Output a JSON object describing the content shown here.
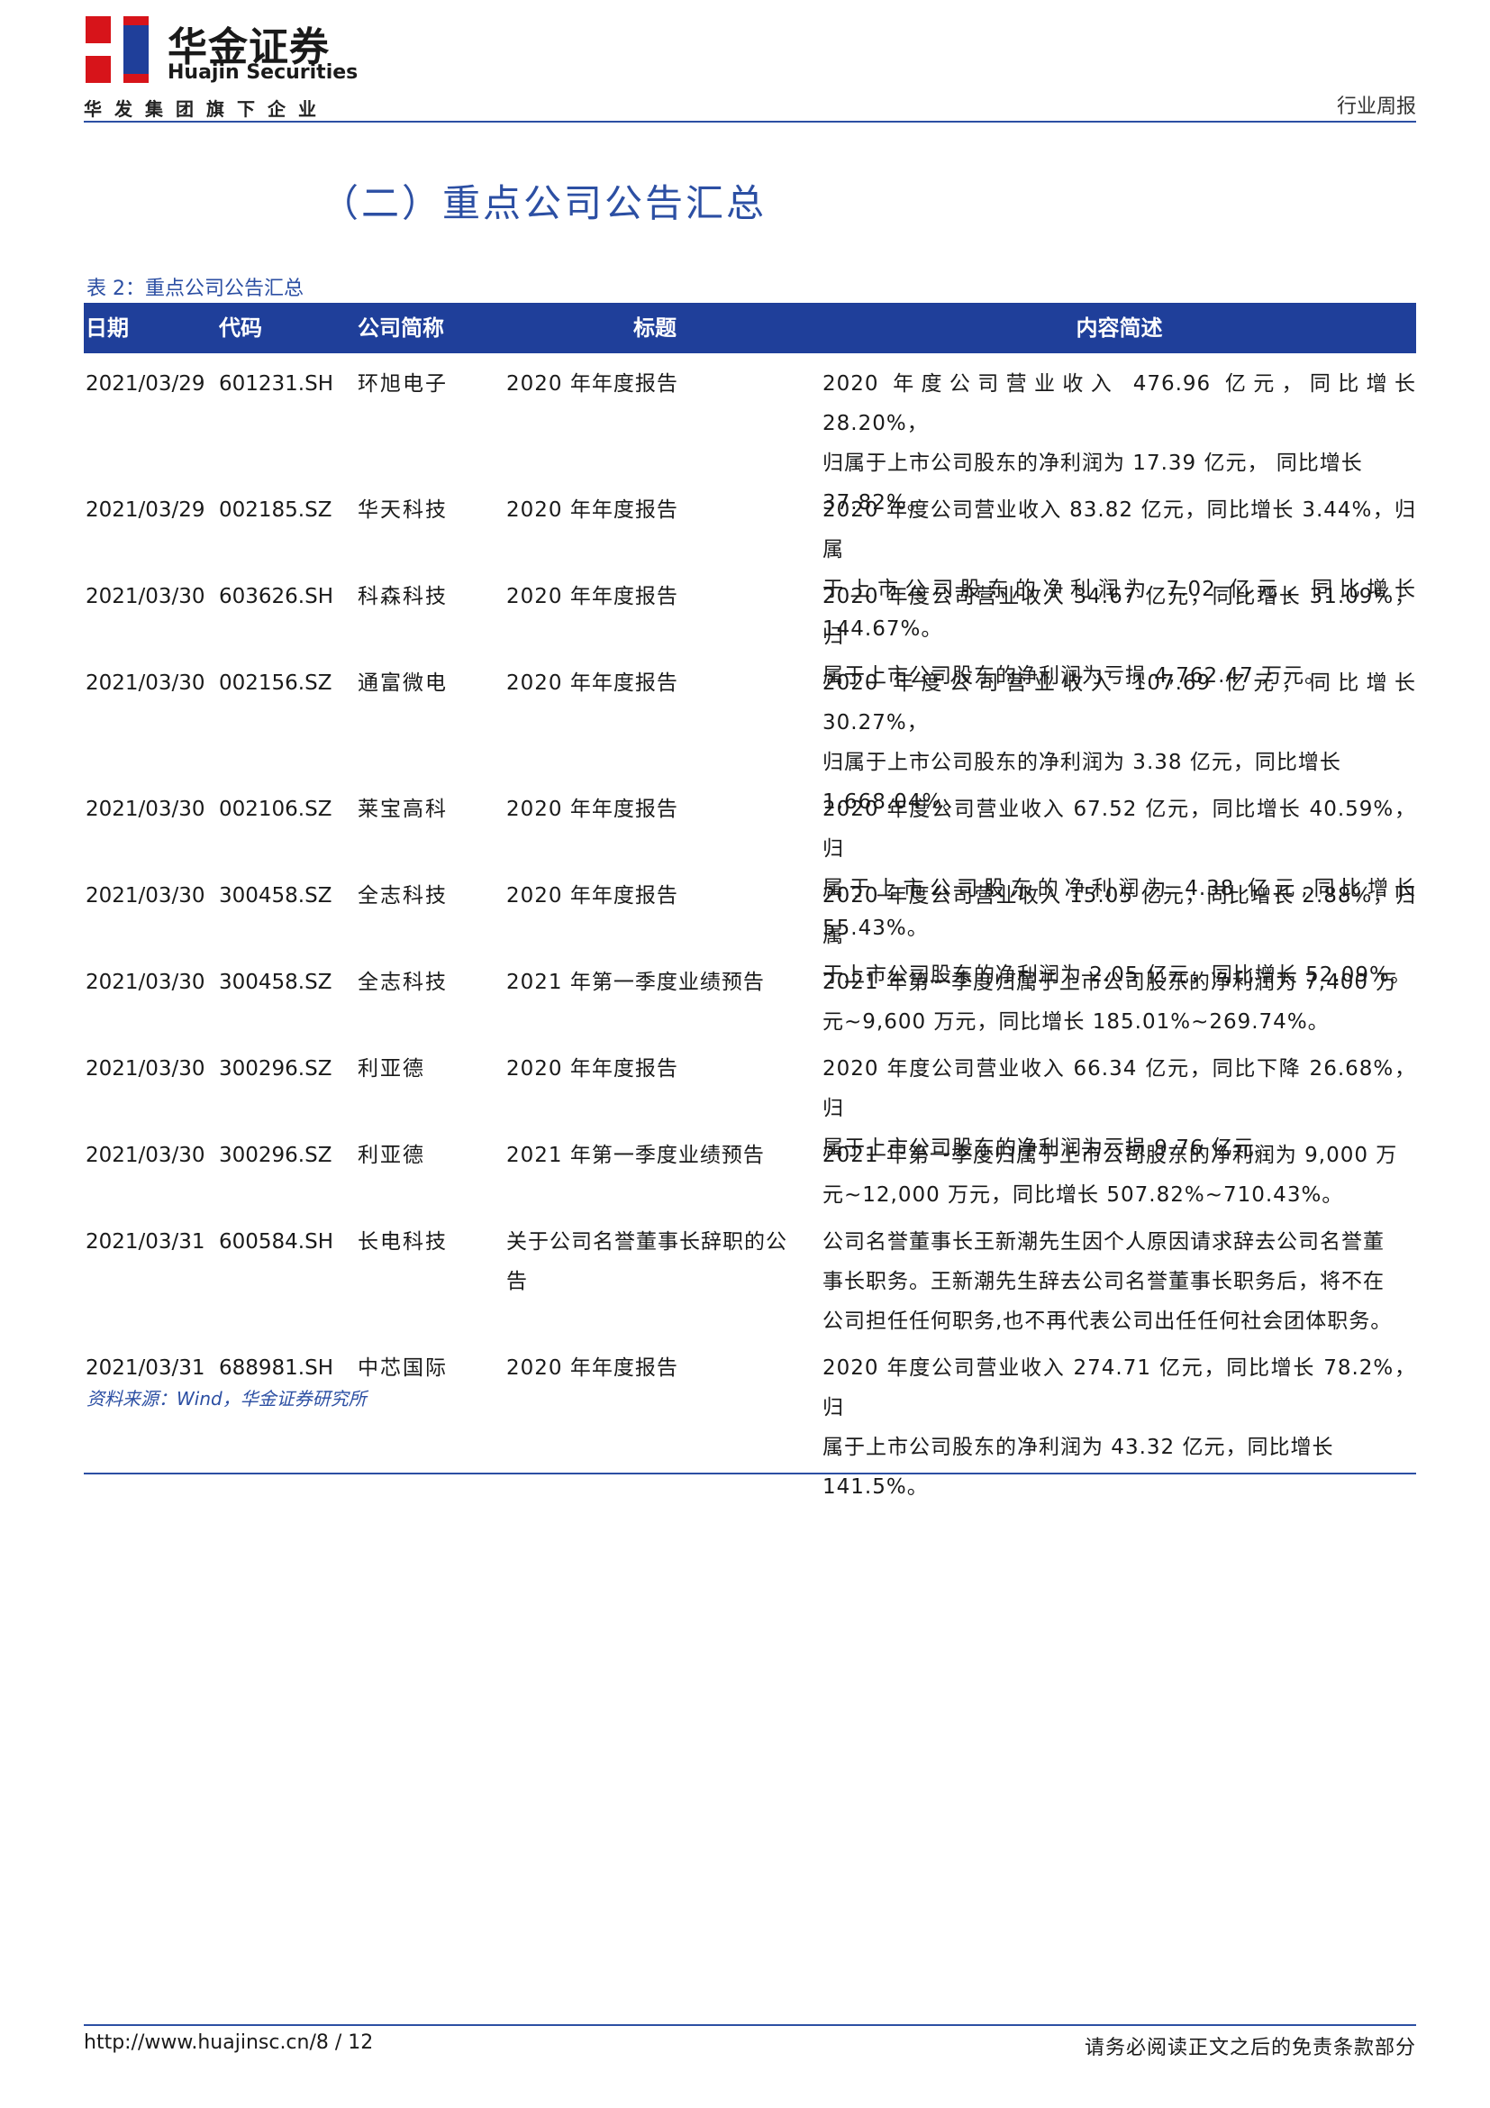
{
  "header": {
    "brand_cn": "华金证券",
    "brand_en": "Huajin Securities",
    "brand_sub": "华发集团旗下企业",
    "doc_type": "行业周报",
    "accent_color": "#2c4fa3",
    "logo_colors": [
      "#d7141a",
      "#1f3f9a"
    ]
  },
  "section_title": "（二）重点公司公告汇总",
  "table_caption": "表 2：重点公司公告汇总",
  "table": {
    "headers": [
      "日期",
      "代码",
      "公司简称",
      "标题",
      "内容简述"
    ],
    "rows": [
      {
        "date": "2021/03/29",
        "code": "601231.SH",
        "name": "环旭电子",
        "title": "2020 年年度报告",
        "desc": [
          "2020 年度公司营业收入 476.96 亿元，同比增长 28.20%，",
          "归属于上市公司股东的净利润为 17.39 亿元， 同比增长",
          "37.82%。"
        ]
      },
      {
        "date": "2021/03/29",
        "code": "002185.SZ",
        "name": "华天科技",
        "title": "2020 年年度报告",
        "desc": [
          "2020 年度公司营业收入 83.82 亿元，同比增长 3.44%，归属",
          "于上市公司股东的净利润为 7.02 亿元，同比增长 144.67%。"
        ]
      },
      {
        "date": "2021/03/30",
        "code": "603626.SH",
        "name": "科森科技",
        "title": "2020 年年度报告",
        "desc": [
          "2020 年度公司营业收入 34.67 亿元，同比增长 31.09%，归",
          "属于上市公司股东的净利润为亏损 4,762.47 万元。"
        ]
      },
      {
        "date": "2021/03/30",
        "code": "002156.SZ",
        "name": "通富微电",
        "title": "2020 年年度报告",
        "desc": [
          "2020 年度公司营业收入 107.69 亿元，同比增长 30.27%，",
          "归属于上市公司股东的净利润为 3.38 亿元，同比增长",
          "1,668.04%。"
        ]
      },
      {
        "date": "2021/03/30",
        "code": "002106.SZ",
        "name": "莱宝高科",
        "title": "2020 年年度报告",
        "desc": [
          "2020 年度公司营业收入 67.52 亿元，同比增长 40.59%，归",
          "属于上市公司股东的净利润为 4.38 亿元,同比增长 55.43%。"
        ]
      },
      {
        "date": "2021/03/30",
        "code": "300458.SZ",
        "name": "全志科技",
        "title": "2020 年年度报告",
        "desc": [
          "2020 年度公司营业收入 15.05 亿元，同比增长 2.88%，归属",
          "于上市公司股东的净利润为 2.05 亿元，同比增长 52.09%。"
        ]
      },
      {
        "date": "2021/03/30",
        "code": "300458.SZ",
        "name": "全志科技",
        "title": "2021 年第一季度业绩预告",
        "desc": [
          "2021 年第一季度归属于上市公司股东的净利润为 7,400 万",
          "元~9,600 万元，同比增长 185.01%~269.74%。"
        ]
      },
      {
        "date": "2021/03/30",
        "code": "300296.SZ",
        "name": "利亚德",
        "title": "2020 年年度报告",
        "desc": [
          "2020 年度公司营业收入 66.34 亿元，同比下降 26.68%，归",
          "属于上市公司股东的净利润为亏损 9.76 亿元。"
        ]
      },
      {
        "date": "2021/03/30",
        "code": "300296.SZ",
        "name": "利亚德",
        "title": "2021 年第一季度业绩预告",
        "desc": [
          "2021 年第一季度归属于上市公司股东的净利润为 9,000 万",
          "元~12,000 万元，同比增长 507.82%~710.43%。"
        ]
      },
      {
        "date": "2021/03/31",
        "code": "600584.SH",
        "name": "长电科技",
        "title": "关于公司名誉董事长辞职的公告",
        "desc": [
          "公司名誉董事长王新潮先生因个人原因请求辞去公司名誉董",
          "事长职务。王新潮先生辞去公司名誉董事长职务后，将不在",
          "公司担任任何职务,也不再代表公司出任任何社会团体职务。"
        ]
      },
      {
        "date": "2021/03/31",
        "code": "688981.SH",
        "name": "中芯国际",
        "title": "2020 年年度报告",
        "desc": [
          "2020 年度公司营业收入 274.71 亿元，同比增长 78.2%，归",
          "属于上市公司股东的净利润为 43.32 亿元，同比增长",
          "141.5%。"
        ]
      }
    ]
  },
  "source_note": "资料来源：Wind，华金证券研究所",
  "footer": {
    "url_page": "http://www.huajinsc.cn/8 / 12",
    "disclaimer": "请务必阅读正文之后的免责条款部分"
  }
}
